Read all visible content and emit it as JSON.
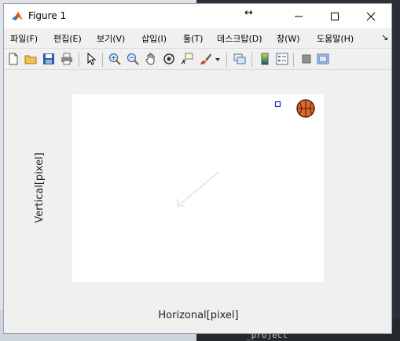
{
  "window": {
    "title": "Figure 1"
  },
  "menu": {
    "items": [
      "파일(F)",
      "편집(E)",
      "보기(V)",
      "삽입(I)",
      "툴(T)",
      "데스크탑(D)",
      "창(W)",
      "도움말(H)"
    ],
    "overflow_icon": "chevron-more-icon"
  },
  "toolbar": {
    "buttons": [
      "new-figure-icon",
      "open-file-icon",
      "save-icon",
      "print-icon",
      "pointer-icon",
      "zoom-in-icon",
      "zoom-out-icon",
      "pan-icon",
      "rotate-3d-icon",
      "data-cursor-icon",
      "brush-icon",
      "brush-dropdown-icon",
      "link-plot-icon",
      "colorbar-icon",
      "legend-icon",
      "hide-plot-tools-icon",
      "show-plot-tools-icon"
    ]
  },
  "plot": {
    "xlabel": "Horizonal[pixel]",
    "ylabel": "Vertical[pixel]",
    "marker_color": "#1f2bd1",
    "ball_color": "#e0662a",
    "trail_color": "#e6e6e6"
  },
  "background": {
    "project_text": "_project"
  }
}
